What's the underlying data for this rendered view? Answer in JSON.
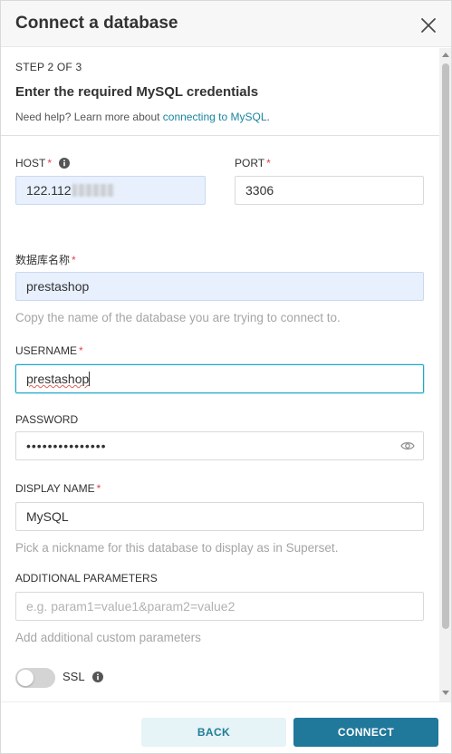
{
  "header": {
    "title": "Connect a database"
  },
  "step": {
    "label": "STEP 2 OF 3",
    "title": "Enter the required MySQL credentials",
    "help_prefix": "Need help? Learn more about ",
    "help_link": "connecting to MySQL",
    "help_suffix": "."
  },
  "fields": {
    "host": {
      "label": "HOST",
      "required": "*",
      "value": "122.112"
    },
    "port": {
      "label": "PORT",
      "required": "*",
      "value": "3306"
    },
    "database": {
      "label": "数据库名称",
      "required": "*",
      "value": "prestashop",
      "hint": "Copy the name of the database you are trying to connect to."
    },
    "username": {
      "label": "USERNAME",
      "required": "*",
      "value": "prestashop"
    },
    "password": {
      "label": "PASSWORD",
      "value": "•••••••••••••••"
    },
    "display_name": {
      "label": "DISPLAY NAME",
      "required": "*",
      "value": "MySQL",
      "hint": "Pick a nickname for this database to display as in Superset."
    },
    "additional": {
      "label": "ADDITIONAL PARAMETERS",
      "placeholder": "e.g. param1=value1&param2=value2",
      "hint": "Add additional custom parameters"
    },
    "ssl": {
      "label": "SSL",
      "enabled": false
    }
  },
  "footer": {
    "back_label": "BACK",
    "connect_label": "CONNECT"
  },
  "colors": {
    "accent": "#20789b",
    "required": "#e04355",
    "link": "#1a85a0"
  },
  "icons": [
    "close-icon",
    "info-icon",
    "eye-icon"
  ]
}
